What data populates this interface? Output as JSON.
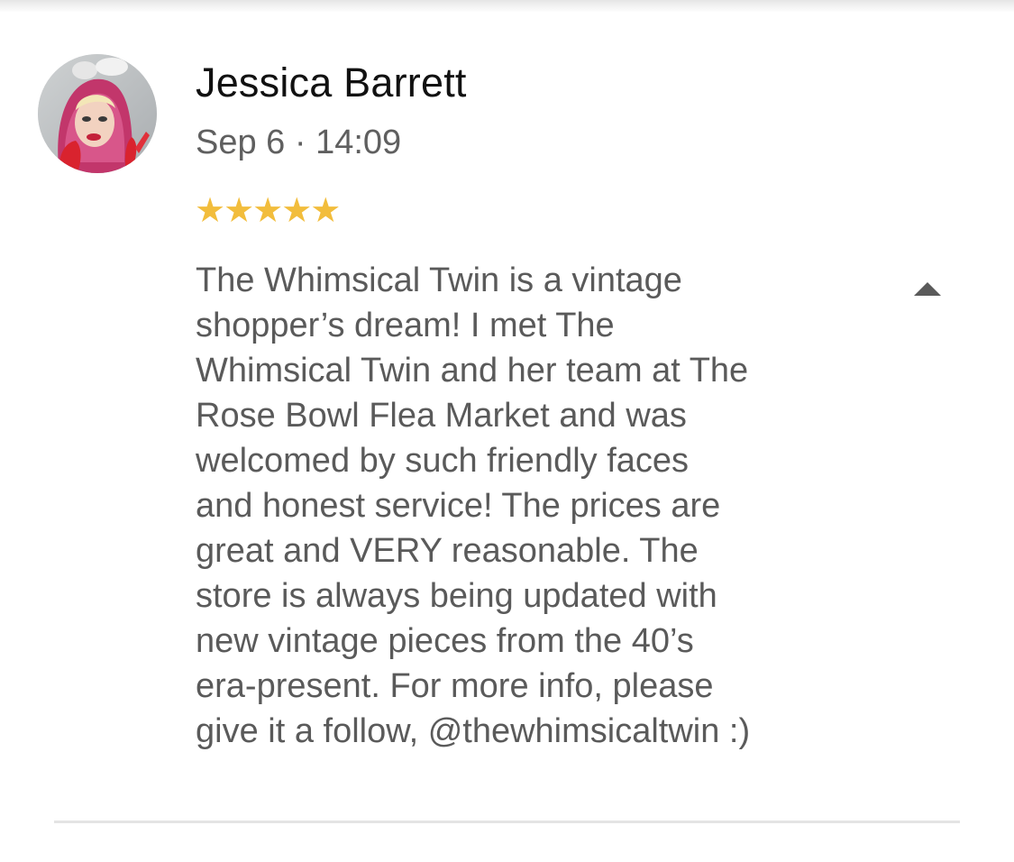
{
  "review": {
    "author_name": "Jessica Barrett",
    "date": "Sep 6 · 14:09",
    "rating": 5,
    "stars": "★★★★★",
    "text": "The Whimsical Twin is a vintage\nshopper’s dream! I met The\nWhimsical Twin and her team at The\nRose Bowl Flea Market and was\nwelcomed by such friendly faces\nand honest service! The prices are\ngreat and VERY reasonable. The\nstore is always being updated with\nnew vintage pieces from the 40’s\nera-present. For more info, please\ngive it a follow, @thewhimsicaltwin :)",
    "collapse_icon": "caret-up-icon"
  },
  "colors": {
    "star": "#f2bd3c",
    "text": "#5a5a5a",
    "name": "#111111",
    "divider": "#e4e4e4"
  }
}
